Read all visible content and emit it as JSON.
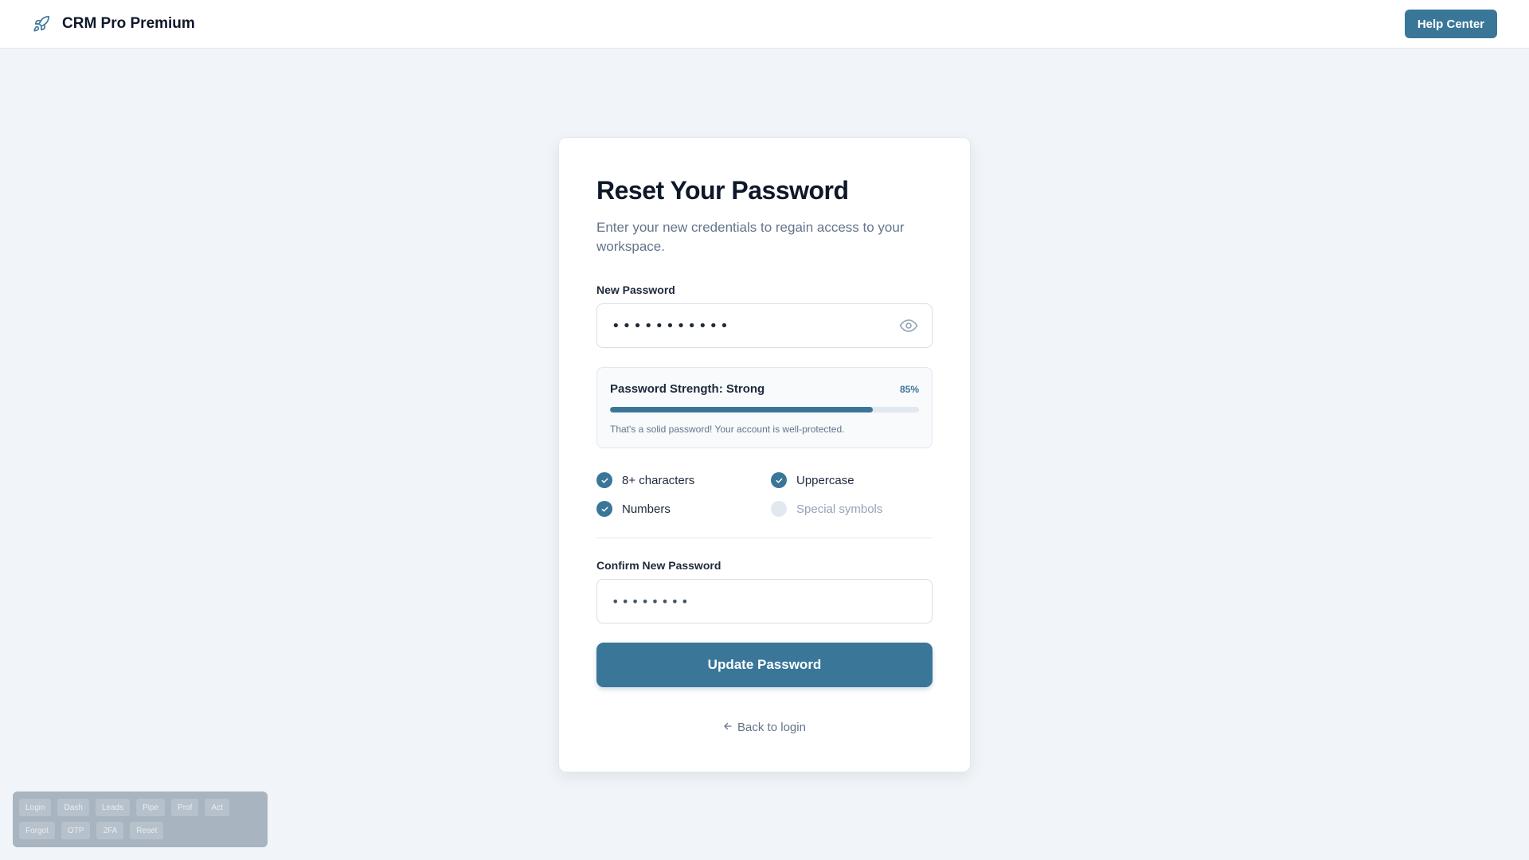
{
  "header": {
    "brand_icon": "rocket-icon",
    "app_name": "CRM Pro Premium",
    "help_label": "Help Center"
  },
  "form": {
    "title": "Reset Your Password",
    "subtitle": "Enter your new credentials to regain access to your workspace.",
    "new_password": {
      "label": "New Password",
      "value": "•••••••••••",
      "toggle_icon": "eye-icon"
    },
    "strength": {
      "title": "Password Strength: Strong",
      "percent_label": "85%",
      "level": 0.85,
      "message": "That's a solid password! Your account is well-protected."
    },
    "requirements": [
      {
        "label": "8+ characters",
        "met": true
      },
      {
        "label": "Uppercase",
        "met": true
      },
      {
        "label": "Numbers",
        "met": true
      },
      {
        "label": "Special symbols",
        "met": false
      }
    ],
    "confirm_password": {
      "label": "Confirm New Password",
      "value": "••••••••"
    },
    "submit_label": "Update Password",
    "back_link": {
      "icon": "arrow-left-icon",
      "label": "Back to login"
    }
  },
  "dev_nav": {
    "row1": [
      "Login",
      "Dash",
      "Leads",
      "Pipe",
      "Prof",
      "Act"
    ],
    "row2": [
      "Forgot",
      "OTP",
      "2FA",
      "Reset"
    ]
  },
  "colors": {
    "accent": "#3a7698",
    "background": "#f1f5f9"
  }
}
